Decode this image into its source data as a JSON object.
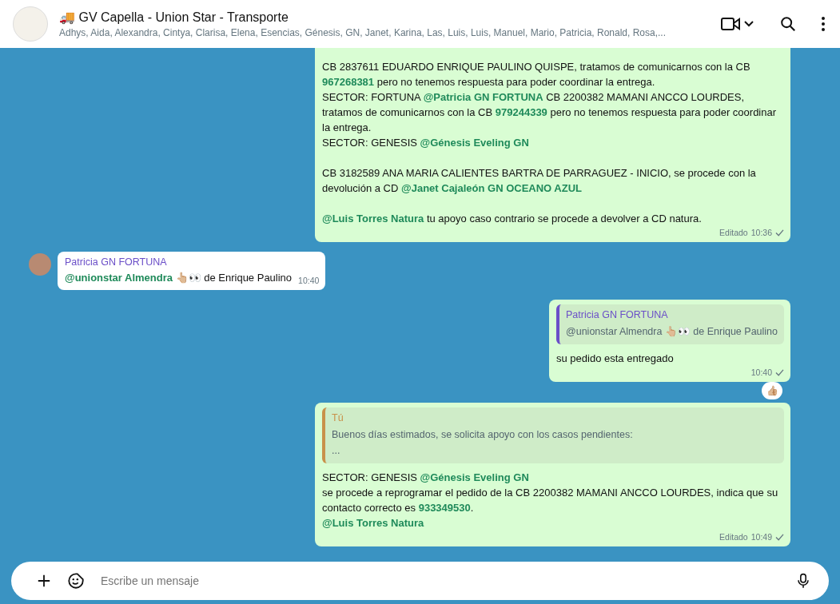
{
  "header": {
    "emoji": "🚚",
    "title": "GV Capella - Union Star - Transporte",
    "members": "Adhys, Aida, Alexandra, Cintya, Clarisa, Elena, Esencias, Génesis, GN, Janet, Karina, Las, Luis, Luis, Manuel, Mario, Patricia, Ronald, Rosa,..."
  },
  "messages": [
    {
      "kind": "outgoing",
      "blocks": [
        [
          "CB 2837611 EDUARDO ENRIQUE PAULINO QUISPE, tratamos de comunicarnos con la CB **967268381** pero no tenemos respuesta para poder coordinar la entrega.",
          "SECTOR: FORTUNA **@Patricia GN FORTUNA** CB 2200382 MAMANI ANCCO LOURDES, tratamos de comunicarnos con la CB **979244339** pero no tenemos respuesta para poder coordinar la entrega.",
          "SECTOR: GENESIS **@Génesis Eveling GN**"
        ],
        [
          "CB 3182589 ANA MARIA CALIENTES BARTRA DE PARRAGUEZ - INICIO, se procede con la devolución a CD **@Janet Cajaleón GN OCEANO AZUL**"
        ],
        [
          "**@Luis Torres Natura** tu apoyo caso contrario se procede a devolver a CD natura."
        ]
      ],
      "edited": "Editado",
      "time": "10:36",
      "check": true
    },
    {
      "kind": "incoming",
      "sender": "Patricia GN FORTUNA",
      "blocks": [
        [
          "**@unionstar Almendra** 👆🏼👀 de Enrique Paulino"
        ]
      ],
      "time": "10:40"
    },
    {
      "kind": "outgoing",
      "quote": {
        "author": "Patricia GN FORTUNA",
        "kind": "other",
        "lines": [
          "@unionstar Almendra 👆🏼👀 de Enrique Paulino"
        ]
      },
      "blocks": [
        [
          "su pedido esta entregado"
        ]
      ],
      "time": "10:40",
      "check": true,
      "reaction": "👍🏼"
    },
    {
      "kind": "outgoing",
      "quote": {
        "author": "Tú",
        "kind": "self",
        "lines": [
          "Buenos días estimados, se solicita apoyo con los casos pendientes:",
          "..."
        ]
      },
      "blocks": [
        [
          "SECTOR: GENESIS **@Génesis Eveling GN**",
          "se procede a reprogramar el pedido de la CB 2200382 MAMANI ANCCO LOURDES, indica que su contacto correcto es **933349530**.",
          "**@Luis Torres Natura**"
        ]
      ],
      "edited": "Editado",
      "time": "10:49",
      "check": true
    }
  ],
  "composer": {
    "placeholder": "Escribe un mensaje"
  }
}
